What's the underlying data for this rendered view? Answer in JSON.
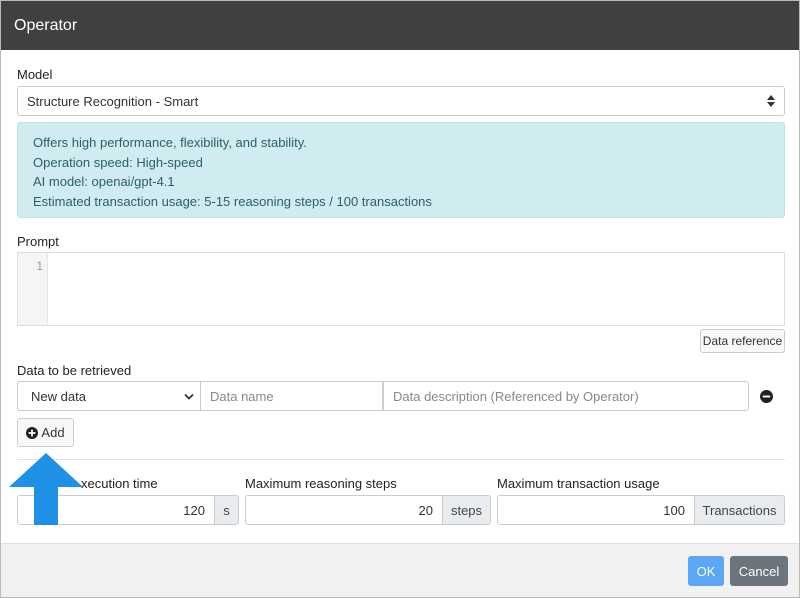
{
  "dialog": {
    "title": "Operator"
  },
  "model": {
    "label": "Model",
    "selected": "Structure Recognition - Smart"
  },
  "info": {
    "lines": [
      "Offers high performance, flexibility, and stability.",
      "Operation speed: High-speed",
      "AI model: openai/gpt-4.1",
      "Estimated transaction usage: 5-15 reasoning steps / 100 transactions"
    ]
  },
  "prompt": {
    "label": "Prompt",
    "line_number": "1",
    "data_reference_label": "Data reference"
  },
  "data_retrieve": {
    "label": "Data to be retrieved",
    "type_selected": "New data",
    "name_placeholder": "Data name",
    "description_placeholder": "Data description (Referenced by Operator)",
    "add_label": "Add"
  },
  "limits": {
    "execution_time": {
      "label": "xecution time",
      "value": "120",
      "unit": "s"
    },
    "reasoning_steps": {
      "label": "Maximum reasoning steps",
      "value": "20",
      "unit": "steps"
    },
    "transaction_usage": {
      "label": "Maximum transaction usage",
      "value": "100",
      "unit": "Transactions"
    }
  },
  "footer": {
    "ok_label": "OK",
    "cancel_label": "Cancel"
  },
  "colors": {
    "titlebar": "#404040",
    "info_bg": "#d1ecf1",
    "ok": "#5aa8f5",
    "cancel": "#6c757d",
    "arrow": "#1e90e6"
  },
  "icons": {
    "model_caret": "updown-caret-icon",
    "type_caret": "chevron-down-icon",
    "remove": "minus-circle-icon",
    "add": "plus-circle-icon",
    "annotation": "up-arrow-icon"
  }
}
